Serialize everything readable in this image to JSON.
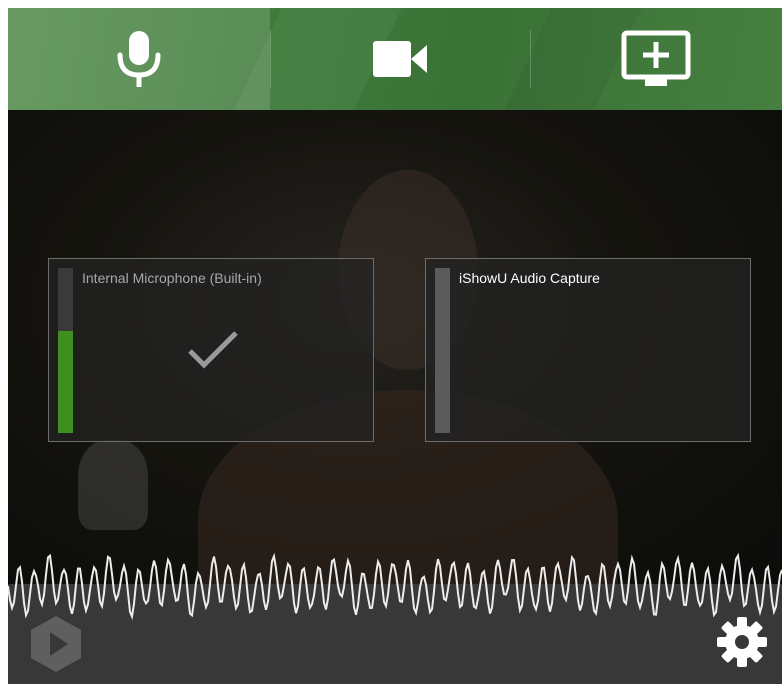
{
  "tabs": [
    {
      "id": "microphone",
      "icon": "microphone-icon",
      "selected": true
    },
    {
      "id": "camera",
      "icon": "video-camera-icon",
      "selected": false
    },
    {
      "id": "screen",
      "icon": "screen-add-icon",
      "selected": false
    }
  ],
  "sources": [
    {
      "label": "Internal Microphone (Built-in)",
      "selected": true,
      "level": 0.62
    },
    {
      "label": "iShowU Audio Capture",
      "selected": false,
      "level": 0
    }
  ],
  "colors": {
    "accent": "#3f7a3a",
    "meter_green": "#3f8f1f",
    "bottom_bar": "#383838"
  },
  "bottom": {
    "logo_icon": "app-logo-icon",
    "settings_icon": "gear-icon"
  }
}
